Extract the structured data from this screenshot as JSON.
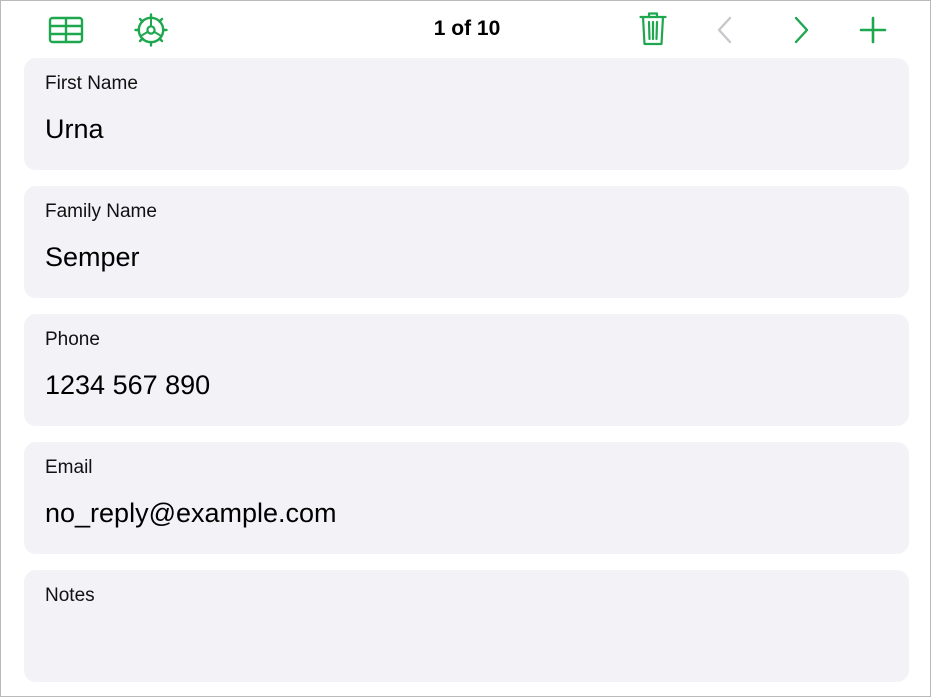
{
  "toolbar": {
    "record_counter": "1 of 10",
    "icons": {
      "table": "table-view-icon",
      "settings": "gear-icon",
      "delete": "trash-icon",
      "previous": "chevron-left-icon",
      "next": "chevron-right-icon",
      "add": "plus-icon"
    },
    "previous_enabled": false
  },
  "fields": [
    {
      "label": "First Name",
      "value": "Urna"
    },
    {
      "label": "Family Name",
      "value": "Semper"
    },
    {
      "label": "Phone",
      "value": "1234 567 890"
    },
    {
      "label": "Email",
      "value": "no_reply@example.com"
    },
    {
      "label": "Notes",
      "value": ""
    }
  ],
  "colors": {
    "accent": "#1fa74f",
    "disabled": "#c7c7cc",
    "card_background": "#f2f2f7"
  }
}
